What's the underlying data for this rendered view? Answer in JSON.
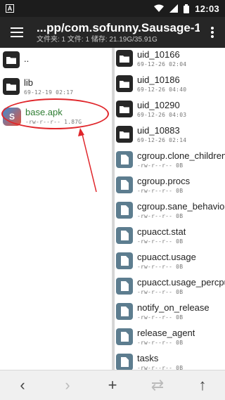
{
  "status_bar": {
    "app_indicator": "A",
    "time": "12:03"
  },
  "toolbar": {
    "title": "...pp/com.sofunny.Sausage-1/",
    "subtitle": "文件夹: 1  文件: 1  储存: 21.19G/35.91G"
  },
  "left_pane": {
    "items": [
      {
        "name": "..",
        "meta": "",
        "icon": "folder-icon"
      },
      {
        "name": "lib",
        "meta": "69-12-19 02:17",
        "icon": "folder-icon"
      },
      {
        "name": "base.apk",
        "meta": "-rw-r--r--  1.87G",
        "icon": "apk-icon"
      }
    ]
  },
  "right_pane": {
    "items": [
      {
        "name": "uid_10166",
        "meta": "69-12-26 02:04",
        "icon": "folder-icon"
      },
      {
        "name": "uid_10186",
        "meta": "69-12-26 04:40",
        "icon": "folder-icon"
      },
      {
        "name": "uid_10290",
        "meta": "69-12-26 04:03",
        "icon": "folder-icon"
      },
      {
        "name": "uid_10883",
        "meta": "69-12-26 02:14",
        "icon": "folder-icon"
      },
      {
        "name": "cgroup.clone_children",
        "meta": "-rw-r--r--  0B",
        "icon": "file-icon"
      },
      {
        "name": "cgroup.procs",
        "meta": "-rw-r--r--  0B",
        "icon": "file-icon"
      },
      {
        "name": "cgroup.sane_behavior",
        "meta": "-rw-r--r--  0B",
        "icon": "file-icon"
      },
      {
        "name": "cpuacct.stat",
        "meta": "-rw-r--r--  0B",
        "icon": "file-icon"
      },
      {
        "name": "cpuacct.usage",
        "meta": "-rw-r--r--  0B",
        "icon": "file-icon"
      },
      {
        "name": "cpuacct.usage_percpu",
        "meta": "-rw-r--r--  0B",
        "icon": "file-icon"
      },
      {
        "name": "notify_on_release",
        "meta": "-rw-r--r--  0B",
        "icon": "file-icon"
      },
      {
        "name": "release_agent",
        "meta": "-rw-r--r--  0B",
        "icon": "file-icon"
      },
      {
        "name": "tasks",
        "meta": "-rw-r--r--  0B",
        "icon": "file-icon"
      }
    ]
  },
  "bottom_bar": {
    "buttons": [
      {
        "icon": "chevron-left-icon",
        "glyph": "‹"
      },
      {
        "icon": "chevron-right-icon",
        "glyph": "›"
      },
      {
        "icon": "plus-icon",
        "glyph": "+"
      },
      {
        "icon": "swap-icon",
        "glyph": "⇄"
      },
      {
        "icon": "arrow-up-icon",
        "glyph": "↑"
      }
    ]
  },
  "colors": {
    "toolbar": "#262626",
    "status_bar": "#1c1c1c",
    "folder_icon": "#262626",
    "file_icon": "#5d7d8f",
    "apk_name": "#2e7d32",
    "annotation": "#e0262b"
  }
}
